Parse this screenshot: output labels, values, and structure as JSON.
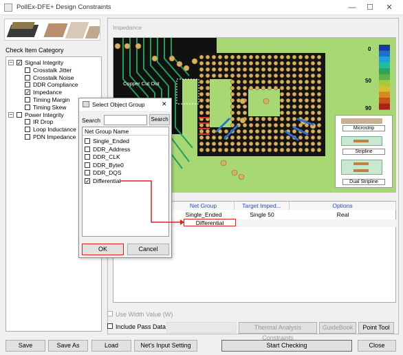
{
  "window": {
    "title": "PollEx-DFE+ Design Constraints",
    "minimize": "—",
    "maximize": "☐",
    "close": "✕"
  },
  "left": {
    "category_label": "Check Item Category",
    "tree": [
      {
        "label": "Signal Integrity",
        "level": 0,
        "expander": "−",
        "checked": true
      },
      {
        "label": "Crosstalk Jitter",
        "level": 1,
        "checked": false
      },
      {
        "label": "Crosstalk Noise",
        "level": 1,
        "checked": false
      },
      {
        "label": "DDR Compliance",
        "level": 1,
        "checked": false
      },
      {
        "label": "Impedance",
        "level": 1,
        "checked": true
      },
      {
        "label": "Timing Margin",
        "level": 1,
        "checked": false
      },
      {
        "label": "Timing Skew",
        "level": 1,
        "checked": false
      },
      {
        "label": "Power Integrity",
        "level": 0,
        "expander": "−",
        "checked": false
      },
      {
        "label": "IR Drop",
        "level": 1,
        "checked": false
      },
      {
        "label": "Loop Inductance",
        "level": 1,
        "checked": false
      },
      {
        "label": "PDN Impedance",
        "level": 1,
        "checked": false
      }
    ]
  },
  "impedance": {
    "title": "Impedance",
    "copper_label": "Copper Cut Out",
    "scale": {
      "labels": [
        "0",
        "50",
        "90"
      ],
      "colors": [
        "#1b3a9c",
        "#1e6fd0",
        "#19a3d8",
        "#1fbfa0",
        "#2aa55a",
        "#5bb34a",
        "#a7c83a",
        "#d4c02e",
        "#d88a22",
        "#c8501c",
        "#b01e1e"
      ]
    },
    "stackup": [
      "Microstrip",
      "Stripline",
      "Dual Stripline"
    ]
  },
  "table": {
    "headers": [
      "Net Group",
      "Target Imped...",
      "Options"
    ],
    "rows": [
      {
        "net_group": "Single_Ended",
        "target": "Single 50",
        "options": "Real"
      },
      {
        "net_group": "Differential",
        "target": "",
        "options": ""
      }
    ]
  },
  "options": {
    "use_width": "Use Width Value (W)",
    "include_pass": "Include Pass Data"
  },
  "tool_buttons": {
    "thermal": "Thermal Analysis Constraints",
    "guidebook": "GuideBook",
    "point_tool": "Point Tool"
  },
  "bottom_buttons": {
    "save": "Save",
    "save_as": "Save As",
    "load": "Load",
    "nets_input": "Net's Input Setting",
    "start": "Start Checking",
    "close": "Close"
  },
  "dialog": {
    "title": "Select Object Group",
    "close": "✕",
    "search_label": "Search",
    "search_value": "",
    "search_button": "Search",
    "list_header": "Net Group Name",
    "items": [
      {
        "label": "Single_Ended",
        "checked": false
      },
      {
        "label": "DDR_Address",
        "checked": false
      },
      {
        "label": "DDR_CLK",
        "checked": false
      },
      {
        "label": "DDR_Byte0",
        "checked": false
      },
      {
        "label": "DDR_DQS",
        "checked": false
      },
      {
        "label": "Differential",
        "checked": true
      }
    ],
    "ok": "OK",
    "cancel": "Cancel"
  },
  "colors": {
    "highlight": "#e02020",
    "accent_blue": "#1c4fd0"
  }
}
